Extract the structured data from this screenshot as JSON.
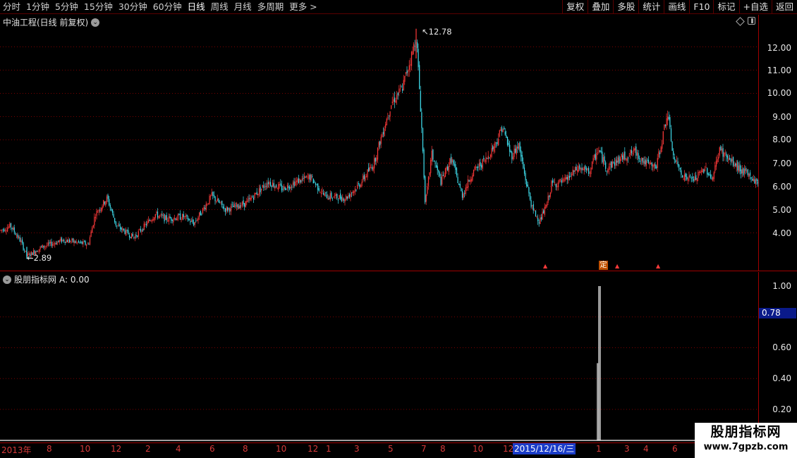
{
  "toolbar": {
    "periods": [
      "分时",
      "1分钟",
      "5分钟",
      "15分钟",
      "30分钟",
      "60分钟",
      "日线",
      "周线",
      "月线",
      "多周期",
      "更多 >"
    ],
    "active_period": "日线",
    "actions": [
      "复权",
      "叠加",
      "多股",
      "统计",
      "画线",
      "F10",
      "标记",
      "+自选",
      "返回"
    ]
  },
  "main_chart": {
    "title": "中油工程(日线 前复权)",
    "y_ticks": [
      "12.00",
      "11.00",
      "10.00",
      "9.00",
      "8.00",
      "7.00",
      "6.00",
      "5.00",
      "4.00"
    ],
    "high_label": "12.78",
    "low_label": "2.89",
    "ding_marker": "定"
  },
  "indicator": {
    "title": "股朋指标网",
    "value_label": "A: 0.00",
    "y_ticks": [
      "1.00",
      "0.60",
      "0.40",
      "0.20"
    ],
    "current_value": "0.78"
  },
  "date_axis": {
    "labels": [
      "2013年",
      "8",
      "10",
      "12",
      "2",
      "4",
      "6",
      "8",
      "10",
      "12",
      "1",
      "3",
      "5",
      "7",
      "8",
      "10",
      "12",
      "1",
      "1",
      "3",
      "4",
      "6"
    ],
    "cursor_date": "2015/12/16/三"
  },
  "watermark": {
    "title": "股朋指标网",
    "url": "www.7gpzb.com"
  },
  "colors": {
    "up": "#ff3a3a",
    "down": "#40e0f0",
    "grid": "#7a0000",
    "border": "#a00000",
    "cursor_bg": "#1a3cc8"
  },
  "chart_data": {
    "type": "candlestick",
    "title": "中油工程(日线 前复权)",
    "ylim": [
      3.0,
      13.0
    ],
    "y_ticks": [
      4,
      5,
      6,
      7,
      8,
      9,
      10,
      11,
      12
    ],
    "trend": [
      [
        0,
        4.1
      ],
      [
        15,
        4.3
      ],
      [
        30,
        3.6
      ],
      [
        38,
        3.0
      ],
      [
        60,
        3.4
      ],
      [
        90,
        3.7
      ],
      [
        125,
        3.5
      ],
      [
        135,
        4.8
      ],
      [
        152,
        5.5
      ],
      [
        165,
        4.3
      ],
      [
        190,
        3.8
      ],
      [
        220,
        4.8
      ],
      [
        235,
        4.6
      ],
      [
        260,
        4.7
      ],
      [
        275,
        4.4
      ],
      [
        300,
        5.6
      ],
      [
        320,
        5.0
      ],
      [
        350,
        5.3
      ],
      [
        380,
        6.2
      ],
      [
        400,
        5.9
      ],
      [
        420,
        6.2
      ],
      [
        440,
        6.4
      ],
      [
        460,
        5.6
      ],
      [
        490,
        5.5
      ],
      [
        510,
        6.1
      ],
      [
        530,
        7.0
      ],
      [
        545,
        8.6
      ],
      [
        555,
        9.6
      ],
      [
        570,
        10.2
      ],
      [
        585,
        11.8
      ],
      [
        590,
        12.5
      ],
      [
        597,
        9.0
      ],
      [
        603,
        5.2
      ],
      [
        612,
        7.4
      ],
      [
        625,
        6.2
      ],
      [
        640,
        7.2
      ],
      [
        655,
        5.6
      ],
      [
        670,
        6.6
      ],
      [
        690,
        7.2
      ],
      [
        705,
        8.0
      ],
      [
        712,
        8.6
      ],
      [
        725,
        7.3
      ],
      [
        735,
        7.8
      ],
      [
        745,
        6.3
      ],
      [
        755,
        5.0
      ],
      [
        765,
        4.5
      ],
      [
        775,
        5.2
      ],
      [
        782,
        6.1
      ],
      [
        800,
        6.2
      ],
      [
        820,
        6.8
      ],
      [
        835,
        6.6
      ],
      [
        848,
        7.6
      ],
      [
        860,
        6.8
      ],
      [
        880,
        7.2
      ],
      [
        900,
        7.5
      ],
      [
        915,
        7.0
      ],
      [
        930,
        6.8
      ],
      [
        940,
        8.2
      ],
      [
        946,
        9.2
      ],
      [
        955,
        7.2
      ],
      [
        970,
        6.4
      ],
      [
        985,
        6.3
      ],
      [
        1000,
        6.8
      ],
      [
        1010,
        6.3
      ],
      [
        1020,
        7.6
      ],
      [
        1035,
        7.1
      ],
      [
        1050,
        6.7
      ],
      [
        1065,
        6.4
      ],
      [
        1075,
        6.1
      ]
    ],
    "high": {
      "value": 12.78,
      "at_x": 590
    },
    "low": {
      "value": 2.89,
      "at_x": 38
    },
    "indicator_series": {
      "name": "A",
      "ylim": [
        0.1,
        1.05
      ],
      "spikes": [
        {
          "at_x": 849,
          "value": 1.0
        },
        {
          "at_x": 847,
          "value": 0.5
        }
      ]
    }
  }
}
